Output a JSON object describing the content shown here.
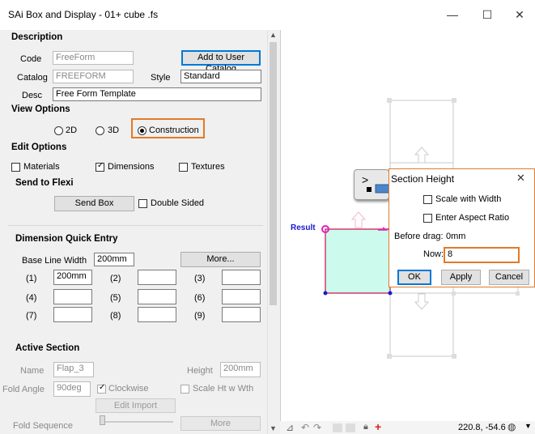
{
  "window": {
    "title": "SAi Box and Display - 01+ cube .fs",
    "min": "—",
    "max": "☐",
    "close": "✕"
  },
  "description": {
    "header": "Description",
    "code_label": "Code",
    "code_value": "FreeForm",
    "add_catalog_button": "Add to User Catalog",
    "catalog_label": "Catalog",
    "catalog_value": "FREEFORM",
    "style_label": "Style",
    "style_value": "Standard",
    "desc_label": "Desc",
    "desc_value": "Free Form Template"
  },
  "view_options": {
    "header": "View Options",
    "opt_2d": "2D",
    "opt_3d": "3D",
    "opt_construction": "Construction",
    "selected": "Construction"
  },
  "edit_options": {
    "header": "Edit Options",
    "materials": "Materials",
    "dimensions": "Dimensions",
    "textures": "Textures"
  },
  "send_to_flexi": {
    "header": "Send to Flexi",
    "send_box": "Send Box",
    "double_sided": "Double Sided"
  },
  "quick_entry": {
    "header": "Dimension Quick Entry",
    "base_line_label": "Base Line Width",
    "base_line_value": "200mm",
    "more_button": "More...",
    "labels": [
      "(1)",
      "(2)",
      "(3)",
      "(4)",
      "(5)",
      "(6)",
      "(7)",
      "(8)",
      "(9)"
    ],
    "values": [
      "200mm",
      "",
      "",
      "",
      "",
      "",
      "",
      "",
      ""
    ]
  },
  "active_section": {
    "header": "Active Section",
    "name_label": "Name",
    "name_value": "Flap_3",
    "height_label": "Height",
    "height_value": "200mm",
    "fold_angle_label": "Fold Angle",
    "fold_angle_value": "90deg",
    "clockwise": "Clockwise",
    "scale_ht": "Scale Ht w Wth",
    "edit_import": "Edit Import",
    "fold_sequence_label": "Fold Sequence",
    "more_button": "More"
  },
  "canvas": {
    "result_label": "Result",
    "coords": "220.8, -54.6"
  },
  "tooltip_icon": ">",
  "dialog": {
    "title": "Section Height",
    "close": "✕",
    "scale_with_width": "Scale with Width",
    "enter_aspect_ratio": "Enter Aspect Ratio",
    "before_drag_label": "Before drag:",
    "before_drag_value": "0mm",
    "now_label": "Now:",
    "now_value": "8",
    "ok": "OK",
    "apply": "Apply",
    "cancel": "Cancel"
  },
  "colors": {
    "accent_orange": "#e07a2a",
    "accent_blue": "#0078d7",
    "shape_fill": "#ccfbee",
    "shape_edge": "#d33a6a",
    "result_blue": "#1a1acc"
  }
}
